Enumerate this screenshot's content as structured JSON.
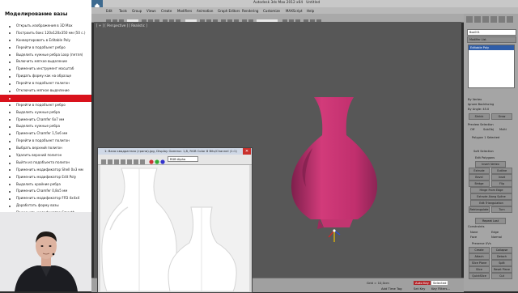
{
  "lesson": {
    "title": "Моделирование вазы",
    "steps": [
      "Открыть изображения в 3D Max",
      "Построить бокс 120x120x350 мм (50 с.)",
      "Конвертировать в Editable Poly",
      "Перейти в подобъект ребро",
      "Выделить нужные ребра Loop (петля)",
      "Включить мягкое выделение",
      "Применить инструмент масштаб",
      "Придать форму как на образце",
      "Перейти в подобъект полигон",
      "Отключить мягкое выделение",
      "",
      "Перейти в подобъект ребро",
      "Выделить нужные ребра",
      "Применить Chamfer 6x7 мм",
      "Выделить нужные ребра",
      "Применить Chamfer 1,5x6 мм",
      "Перейти в подобъект полигон",
      "Выбрать верхний полигон",
      "Удалить верхний полигон",
      "Выйти из подобъекта полигон",
      "Применить модификатор Shell 0x3 мм",
      "Применить модификатор Edit Poly",
      "Выделить крайние ребра",
      "Применить Chamfer 0,8x5 мм",
      "Применить модификатор FFD 4x4x4",
      "Доработать форму вазы",
      "Применить модификатор Smooth"
    ]
  },
  "app": {
    "window_title": "Autodesk 3ds Max 2012 x64",
    "doc_title": "Untitled",
    "menu": [
      "Edit",
      "Tools",
      "Group",
      "Views",
      "Create",
      "Modifiers",
      "Animation",
      "Graph Editors",
      "Rendering",
      "Customize",
      "MAXScript",
      "Help"
    ],
    "viewport_label": "[ + ] [ Perspective ] [ Realistic ]",
    "command_panel": {
      "object_name": "Box001",
      "modifier_list": "Modifier List",
      "modifier_stack": [
        "Editable Poly"
      ],
      "soft_selection": [
        "By Vertex",
        "Ignore Backfacing",
        "By Angle: 45.0",
        "Shrink",
        "Grow"
      ],
      "preview_selection": [
        "Preview Selection",
        "Off",
        "SubObj",
        "Multi"
      ],
      "polygon_selected": "Polygon 1 Selected",
      "edit_geometry": [
        "Repeat Last",
        "Constraints",
        "None",
        "Edge",
        "Face",
        "Normal",
        "Preserve UVs",
        "Create",
        "Collapse",
        "Attach",
        "Detach",
        "Slice Plane",
        "Split",
        "Slice",
        "Reset Plane",
        "QuickSlice",
        "Cut"
      ],
      "edit_polygons": [
        "Edit Polygons",
        "Insert Vertex",
        "Extrude",
        "Outline",
        "Bevel",
        "Inset",
        "Bridge",
        "Flip",
        "Hinge From Edge",
        "Extrude Along Spline",
        "Edit Triangulation",
        "Retriangulate",
        "Turn"
      ],
      "soft_selection_section": "Soft Selection"
    },
    "status": {
      "left": "Add Time Tag",
      "grid": "Grid = 10,0cm",
      "auto_key": "Auto Key",
      "selected": "Selected",
      "set_key": "Set Key",
      "key_filters": "Key Filters..."
    }
  },
  "reference_window": {
    "title": "1: Ваза квадратная (грани).jpg, Display Gamma: 1,8, RGB Color 8 Bits/Channel (1:1)",
    "channel": "RGB Alpha"
  },
  "colors": {
    "vase": "#d23b7a",
    "lesson_highlight": "#d9121c"
  }
}
